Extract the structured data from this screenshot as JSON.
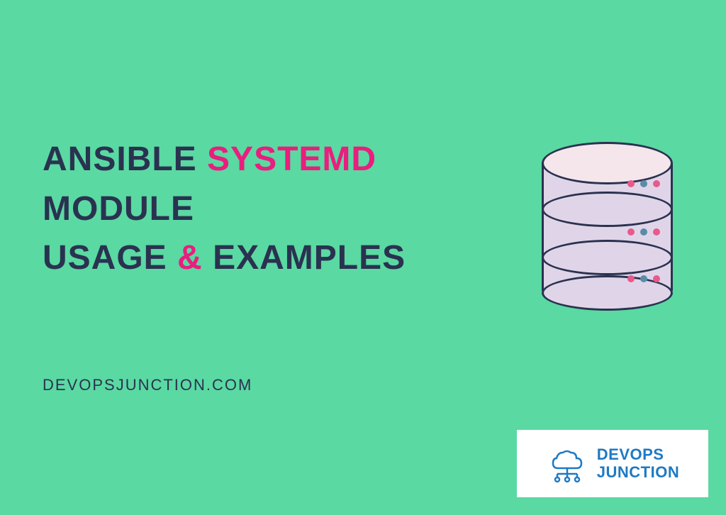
{
  "title": {
    "word1": "Ansible",
    "word2": "Systemd",
    "word3": "module",
    "word4": "Usage",
    "amp": "&",
    "word5": "Examples"
  },
  "subtitle": "devopsjunction.com",
  "logo": {
    "line1": "DEVOPS",
    "line2": "JUNCTION"
  },
  "colors": {
    "bg": "#5ad9a2",
    "dark": "#2a3250",
    "pink": "#e91e7e",
    "logo_blue": "#1e7ac4"
  }
}
